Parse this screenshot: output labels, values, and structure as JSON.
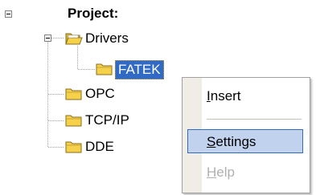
{
  "tree": {
    "root": {
      "label": "Project:",
      "expanded": true
    },
    "drivers": {
      "label": "Drivers",
      "expanded": true
    },
    "fatek": {
      "label": "FATEK",
      "selected": true
    },
    "opc": {
      "label": "OPC"
    },
    "tcpip": {
      "label": "TCP/IP"
    },
    "dde": {
      "label": "DDE"
    }
  },
  "context_menu": {
    "items": [
      {
        "label": "Insert",
        "mnemonic": "I",
        "rest": "nsert",
        "state": "normal"
      },
      {
        "label": "Settings",
        "mnemonic": "S",
        "rest": "ettings",
        "state": "highlighted"
      },
      {
        "label": "Help",
        "mnemonic": "H",
        "rest": "elp",
        "state": "disabled"
      }
    ]
  },
  "colors": {
    "selection": "#316ac5",
    "menu_highlight": "#c1d2ee",
    "folder": "#f5d24a",
    "disabled_text": "#b0b0b0"
  }
}
